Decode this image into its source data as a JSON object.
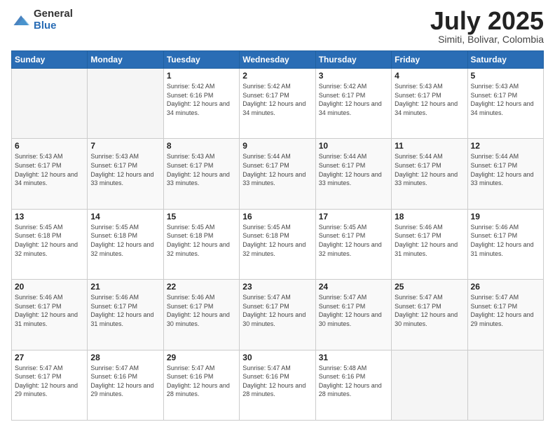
{
  "header": {
    "logo_general": "General",
    "logo_blue": "Blue",
    "month_title": "July 2025",
    "subtitle": "Simiti, Bolivar, Colombia"
  },
  "weekdays": [
    "Sunday",
    "Monday",
    "Tuesday",
    "Wednesday",
    "Thursday",
    "Friday",
    "Saturday"
  ],
  "weeks": [
    [
      {
        "day": "",
        "sunrise": "",
        "sunset": "",
        "daylight": ""
      },
      {
        "day": "",
        "sunrise": "",
        "sunset": "",
        "daylight": ""
      },
      {
        "day": "1",
        "sunrise": "Sunrise: 5:42 AM",
        "sunset": "Sunset: 6:16 PM",
        "daylight": "Daylight: 12 hours and 34 minutes."
      },
      {
        "day": "2",
        "sunrise": "Sunrise: 5:42 AM",
        "sunset": "Sunset: 6:17 PM",
        "daylight": "Daylight: 12 hours and 34 minutes."
      },
      {
        "day": "3",
        "sunrise": "Sunrise: 5:42 AM",
        "sunset": "Sunset: 6:17 PM",
        "daylight": "Daylight: 12 hours and 34 minutes."
      },
      {
        "day": "4",
        "sunrise": "Sunrise: 5:43 AM",
        "sunset": "Sunset: 6:17 PM",
        "daylight": "Daylight: 12 hours and 34 minutes."
      },
      {
        "day": "5",
        "sunrise": "Sunrise: 5:43 AM",
        "sunset": "Sunset: 6:17 PM",
        "daylight": "Daylight: 12 hours and 34 minutes."
      }
    ],
    [
      {
        "day": "6",
        "sunrise": "Sunrise: 5:43 AM",
        "sunset": "Sunset: 6:17 PM",
        "daylight": "Daylight: 12 hours and 34 minutes."
      },
      {
        "day": "7",
        "sunrise": "Sunrise: 5:43 AM",
        "sunset": "Sunset: 6:17 PM",
        "daylight": "Daylight: 12 hours and 33 minutes."
      },
      {
        "day": "8",
        "sunrise": "Sunrise: 5:43 AM",
        "sunset": "Sunset: 6:17 PM",
        "daylight": "Daylight: 12 hours and 33 minutes."
      },
      {
        "day": "9",
        "sunrise": "Sunrise: 5:44 AM",
        "sunset": "Sunset: 6:17 PM",
        "daylight": "Daylight: 12 hours and 33 minutes."
      },
      {
        "day": "10",
        "sunrise": "Sunrise: 5:44 AM",
        "sunset": "Sunset: 6:17 PM",
        "daylight": "Daylight: 12 hours and 33 minutes."
      },
      {
        "day": "11",
        "sunrise": "Sunrise: 5:44 AM",
        "sunset": "Sunset: 6:17 PM",
        "daylight": "Daylight: 12 hours and 33 minutes."
      },
      {
        "day": "12",
        "sunrise": "Sunrise: 5:44 AM",
        "sunset": "Sunset: 6:17 PM",
        "daylight": "Daylight: 12 hours and 33 minutes."
      }
    ],
    [
      {
        "day": "13",
        "sunrise": "Sunrise: 5:45 AM",
        "sunset": "Sunset: 6:18 PM",
        "daylight": "Daylight: 12 hours and 32 minutes."
      },
      {
        "day": "14",
        "sunrise": "Sunrise: 5:45 AM",
        "sunset": "Sunset: 6:18 PM",
        "daylight": "Daylight: 12 hours and 32 minutes."
      },
      {
        "day": "15",
        "sunrise": "Sunrise: 5:45 AM",
        "sunset": "Sunset: 6:18 PM",
        "daylight": "Daylight: 12 hours and 32 minutes."
      },
      {
        "day": "16",
        "sunrise": "Sunrise: 5:45 AM",
        "sunset": "Sunset: 6:18 PM",
        "daylight": "Daylight: 12 hours and 32 minutes."
      },
      {
        "day": "17",
        "sunrise": "Sunrise: 5:45 AM",
        "sunset": "Sunset: 6:17 PM",
        "daylight": "Daylight: 12 hours and 32 minutes."
      },
      {
        "day": "18",
        "sunrise": "Sunrise: 5:46 AM",
        "sunset": "Sunset: 6:17 PM",
        "daylight": "Daylight: 12 hours and 31 minutes."
      },
      {
        "day": "19",
        "sunrise": "Sunrise: 5:46 AM",
        "sunset": "Sunset: 6:17 PM",
        "daylight": "Daylight: 12 hours and 31 minutes."
      }
    ],
    [
      {
        "day": "20",
        "sunrise": "Sunrise: 5:46 AM",
        "sunset": "Sunset: 6:17 PM",
        "daylight": "Daylight: 12 hours and 31 minutes."
      },
      {
        "day": "21",
        "sunrise": "Sunrise: 5:46 AM",
        "sunset": "Sunset: 6:17 PM",
        "daylight": "Daylight: 12 hours and 31 minutes."
      },
      {
        "day": "22",
        "sunrise": "Sunrise: 5:46 AM",
        "sunset": "Sunset: 6:17 PM",
        "daylight": "Daylight: 12 hours and 30 minutes."
      },
      {
        "day": "23",
        "sunrise": "Sunrise: 5:47 AM",
        "sunset": "Sunset: 6:17 PM",
        "daylight": "Daylight: 12 hours and 30 minutes."
      },
      {
        "day": "24",
        "sunrise": "Sunrise: 5:47 AM",
        "sunset": "Sunset: 6:17 PM",
        "daylight": "Daylight: 12 hours and 30 minutes."
      },
      {
        "day": "25",
        "sunrise": "Sunrise: 5:47 AM",
        "sunset": "Sunset: 6:17 PM",
        "daylight": "Daylight: 12 hours and 30 minutes."
      },
      {
        "day": "26",
        "sunrise": "Sunrise: 5:47 AM",
        "sunset": "Sunset: 6:17 PM",
        "daylight": "Daylight: 12 hours and 29 minutes."
      }
    ],
    [
      {
        "day": "27",
        "sunrise": "Sunrise: 5:47 AM",
        "sunset": "Sunset: 6:17 PM",
        "daylight": "Daylight: 12 hours and 29 minutes."
      },
      {
        "day": "28",
        "sunrise": "Sunrise: 5:47 AM",
        "sunset": "Sunset: 6:16 PM",
        "daylight": "Daylight: 12 hours and 29 minutes."
      },
      {
        "day": "29",
        "sunrise": "Sunrise: 5:47 AM",
        "sunset": "Sunset: 6:16 PM",
        "daylight": "Daylight: 12 hours and 28 minutes."
      },
      {
        "day": "30",
        "sunrise": "Sunrise: 5:47 AM",
        "sunset": "Sunset: 6:16 PM",
        "daylight": "Daylight: 12 hours and 28 minutes."
      },
      {
        "day": "31",
        "sunrise": "Sunrise: 5:48 AM",
        "sunset": "Sunset: 6:16 PM",
        "daylight": "Daylight: 12 hours and 28 minutes."
      },
      {
        "day": "",
        "sunrise": "",
        "sunset": "",
        "daylight": ""
      },
      {
        "day": "",
        "sunrise": "",
        "sunset": "",
        "daylight": ""
      }
    ]
  ]
}
